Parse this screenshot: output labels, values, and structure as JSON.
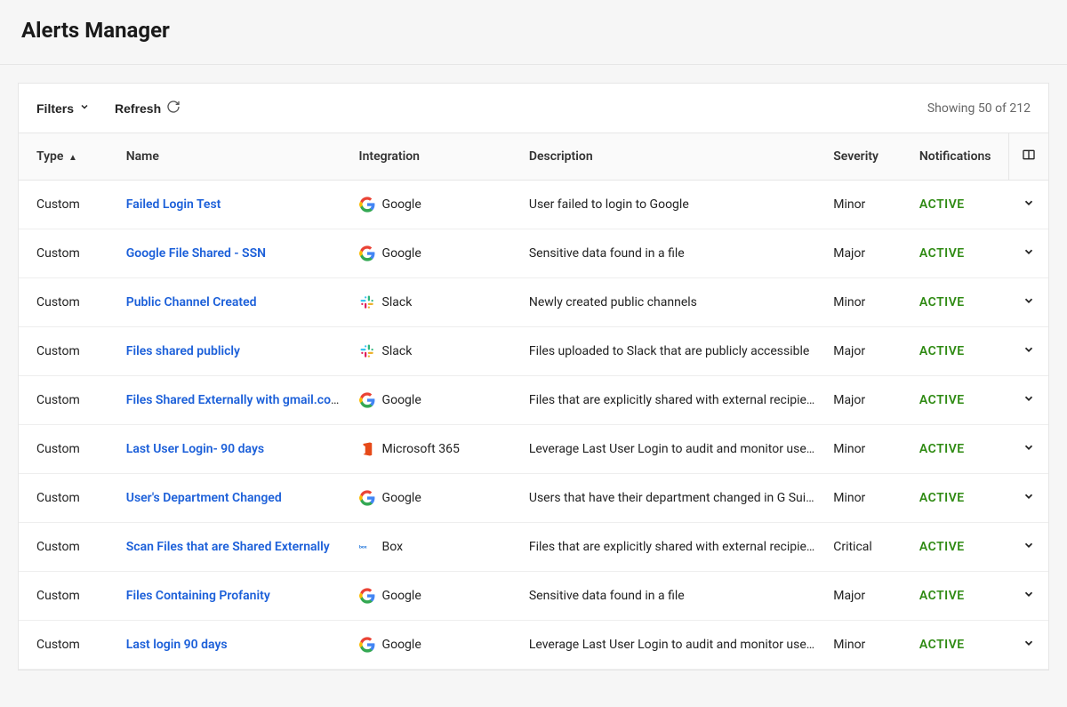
{
  "header": {
    "title": "Alerts Manager"
  },
  "toolbar": {
    "filters_label": "Filters",
    "refresh_label": "Refresh",
    "showing_text": "Showing 50 of 212"
  },
  "columns": {
    "type": "Type",
    "name": "Name",
    "integration": "Integration",
    "description": "Description",
    "severity": "Severity",
    "notifications": "Notifications"
  },
  "rows": [
    {
      "type": "Custom",
      "name": "Failed Login Test",
      "integration": "Google",
      "integration_icon": "google",
      "description": "User failed to login to Google",
      "severity": "Minor",
      "notifications": "ACTIVE"
    },
    {
      "type": "Custom",
      "name": "Google File Shared - SSN",
      "integration": "Google",
      "integration_icon": "google",
      "description": "Sensitive data found in a file",
      "severity": "Major",
      "notifications": "ACTIVE"
    },
    {
      "type": "Custom",
      "name": "Public Channel Created",
      "integration": "Slack",
      "integration_icon": "slack",
      "description": "Newly created public channels",
      "severity": "Minor",
      "notifications": "ACTIVE"
    },
    {
      "type": "Custom",
      "name": "Files shared publicly",
      "integration": "Slack",
      "integration_icon": "slack",
      "description": "Files uploaded to Slack that are publicly accessible",
      "severity": "Major",
      "notifications": "ACTIVE"
    },
    {
      "type": "Custom",
      "name": "Files Shared Externally with gmail.com",
      "integration": "Google",
      "integration_icon": "google",
      "description": "Files that are explicitly shared with external recipients",
      "severity": "Major",
      "notifications": "ACTIVE"
    },
    {
      "type": "Custom",
      "name": "Last User Login- 90 days",
      "integration": "Microsoft 365",
      "integration_icon": "microsoft365",
      "description": "Leverage Last User Login to audit and monitor user sign…",
      "severity": "Minor",
      "notifications": "ACTIVE"
    },
    {
      "type": "Custom",
      "name": "User's Department Changed",
      "integration": "Google",
      "integration_icon": "google",
      "description": "Users that have their department changed in G Suite",
      "severity": "Minor",
      "notifications": "ACTIVE"
    },
    {
      "type": "Custom",
      "name": "Scan Files that are Shared Externally",
      "integration": "Box",
      "integration_icon": "box",
      "description": "Files that are explicitly shared with external recipients …",
      "severity": "Critical",
      "notifications": "ACTIVE"
    },
    {
      "type": "Custom",
      "name": "Files Containing Profanity",
      "integration": "Google",
      "integration_icon": "google",
      "description": "Sensitive data found in a file",
      "severity": "Major",
      "notifications": "ACTIVE"
    },
    {
      "type": "Custom",
      "name": "Last login 90 days",
      "integration": "Google",
      "integration_icon": "google",
      "description": "Leverage Last User Login to audit and monitor user sign…",
      "severity": "Minor",
      "notifications": "ACTIVE"
    }
  ]
}
